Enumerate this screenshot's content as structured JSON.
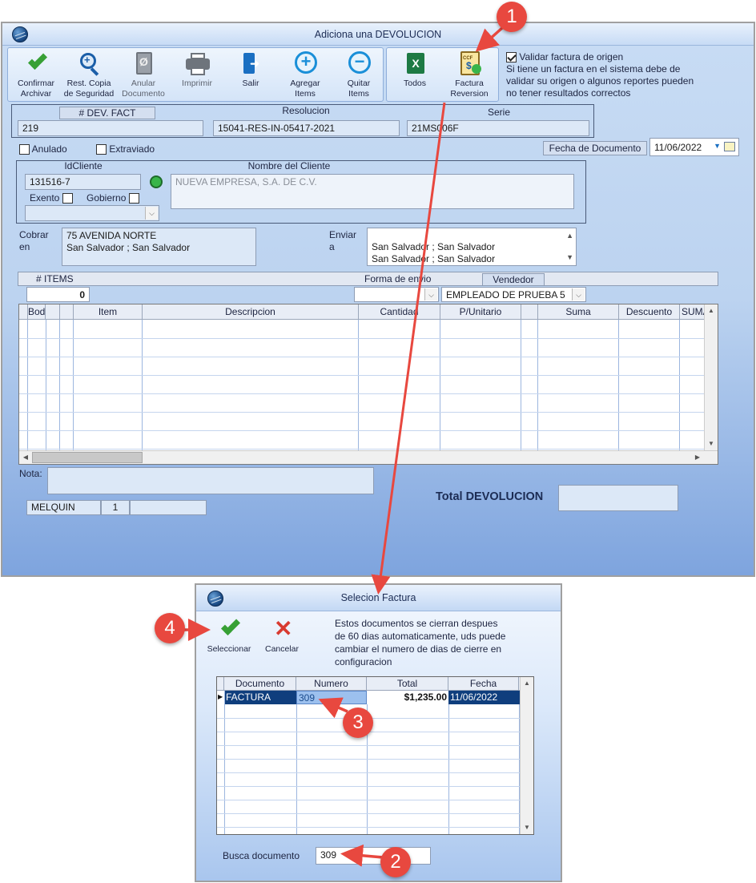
{
  "main_window": {
    "title": "Adiciona una DEVOLUCION",
    "toolbar": [
      {
        "name": "confirmar-archivar-button",
        "line1": "Confirmar",
        "line2": "Archivar",
        "icon": "check-icon",
        "enabled": true
      },
      {
        "name": "rest-copia-button",
        "line1": "Rest. Copia",
        "line2": "de Seguridad",
        "icon": "magnifier-plus-icon",
        "enabled": true
      },
      {
        "name": "anular-documento-button",
        "line1": "Anular",
        "line2": "Documento",
        "icon": "void-document-icon",
        "enabled": false
      },
      {
        "name": "imprimir-button",
        "line1": "Imprimir",
        "line2": "",
        "icon": "printer-icon",
        "enabled": false
      },
      {
        "name": "salir-button",
        "line1": "Salir",
        "line2": "",
        "icon": "exit-icon",
        "enabled": true
      },
      {
        "name": "agregar-items-button",
        "line1": "Agregar",
        "line2": "Items",
        "icon": "plus-circle-icon",
        "enabled": true
      },
      {
        "name": "quitar-items-button",
        "line1": "Quitar",
        "line2": "Items",
        "icon": "minus-circle-icon",
        "enabled": true
      }
    ],
    "toolbar2": [
      {
        "name": "todos-button",
        "line1": "Todos",
        "line2": "",
        "icon": "excel-icon"
      },
      {
        "name": "factura-reversion-button",
        "line1": "Factura",
        "line2": "Reversion",
        "icon": "invoice-check-icon"
      }
    ],
    "validar": {
      "label": "Validar factura de origen",
      "checked": true,
      "note_1": "Si tiene un factura en el sistema debe de",
      "note_2": "validar su origen o algunos reportes pueden",
      "note_3": "no tener resultados correctos"
    },
    "doc_header": {
      "dev_fact_label": "# DEV. FACT",
      "resolucion_label": "Resolucion",
      "serie_label": "Serie",
      "dev_fact_value": "219",
      "resolucion_value": "15041-RES-IN-05417-2021",
      "serie_value": "21MS006F"
    },
    "anulado_label": "Anulado",
    "extraviado_label": "Extraviado",
    "fecha_label": "Fecha de  Documento",
    "fecha_value": "11/06/2022",
    "cliente": {
      "id_label": "IdCliente",
      "nombre_label": "Nombre del Cliente",
      "id_value": "131516-7",
      "nombre_value": "NUEVA EMPRESA, S.A. DE C.V.",
      "exento_label": "Exento",
      "gobierno_label": "Gobierno"
    },
    "cobrar_label_1": "Cobrar",
    "cobrar_label_2": "en",
    "cobrar_line1": "75 AVENIDA NORTE",
    "cobrar_line2": "San Salvador ; San Salvador",
    "enviar_label_1": "Enviar",
    "enviar_label_2": "a",
    "enviar_line1": "San Salvador ; San Salvador",
    "enviar_line2": "San Salvador ; San Salvador",
    "items_label": "# ITEMS",
    "items_count": "0",
    "forma_envio_label": "Forma de envio",
    "vendedor_label": "Vendedor",
    "vendedor_value": "EMPLEADO DE PRUEBA 5",
    "grid_columns": [
      "Bodega",
      "",
      "",
      "Item",
      "Descripcion",
      "Cantidad",
      "P/Unitario",
      "",
      "Suma",
      "Descuento",
      "SUMA"
    ],
    "nota_label": "Nota:",
    "total_label": "Total DEVOLUCION",
    "status": {
      "user": "MELQUIN",
      "num": "1"
    }
  },
  "dialog": {
    "title": "Selecion Factura",
    "seleccionar_label": "Seleccionar",
    "cancelar_label": "Cancelar",
    "info_1": "Estos documentos se cierran despues",
    "info_2": "de 60 dias automaticamente, uds puede",
    "info_3": "cambiar el numero de dias de cierre en",
    "info_4": "configuracion",
    "columns": [
      "Documento",
      "Numero",
      "Total",
      "Fecha"
    ],
    "rows": [
      {
        "documento": "FACTURA",
        "numero": "309",
        "total": "$1,235.00",
        "fecha": "11/06/2022"
      }
    ],
    "busca_label": "Busca documento",
    "busca_value": "309"
  },
  "annotations": [
    "1",
    "2",
    "3",
    "4"
  ],
  "colors": {
    "annotation": "#e8483f",
    "selected_row": "#0f3e7d",
    "accent_check": "#37a035"
  }
}
